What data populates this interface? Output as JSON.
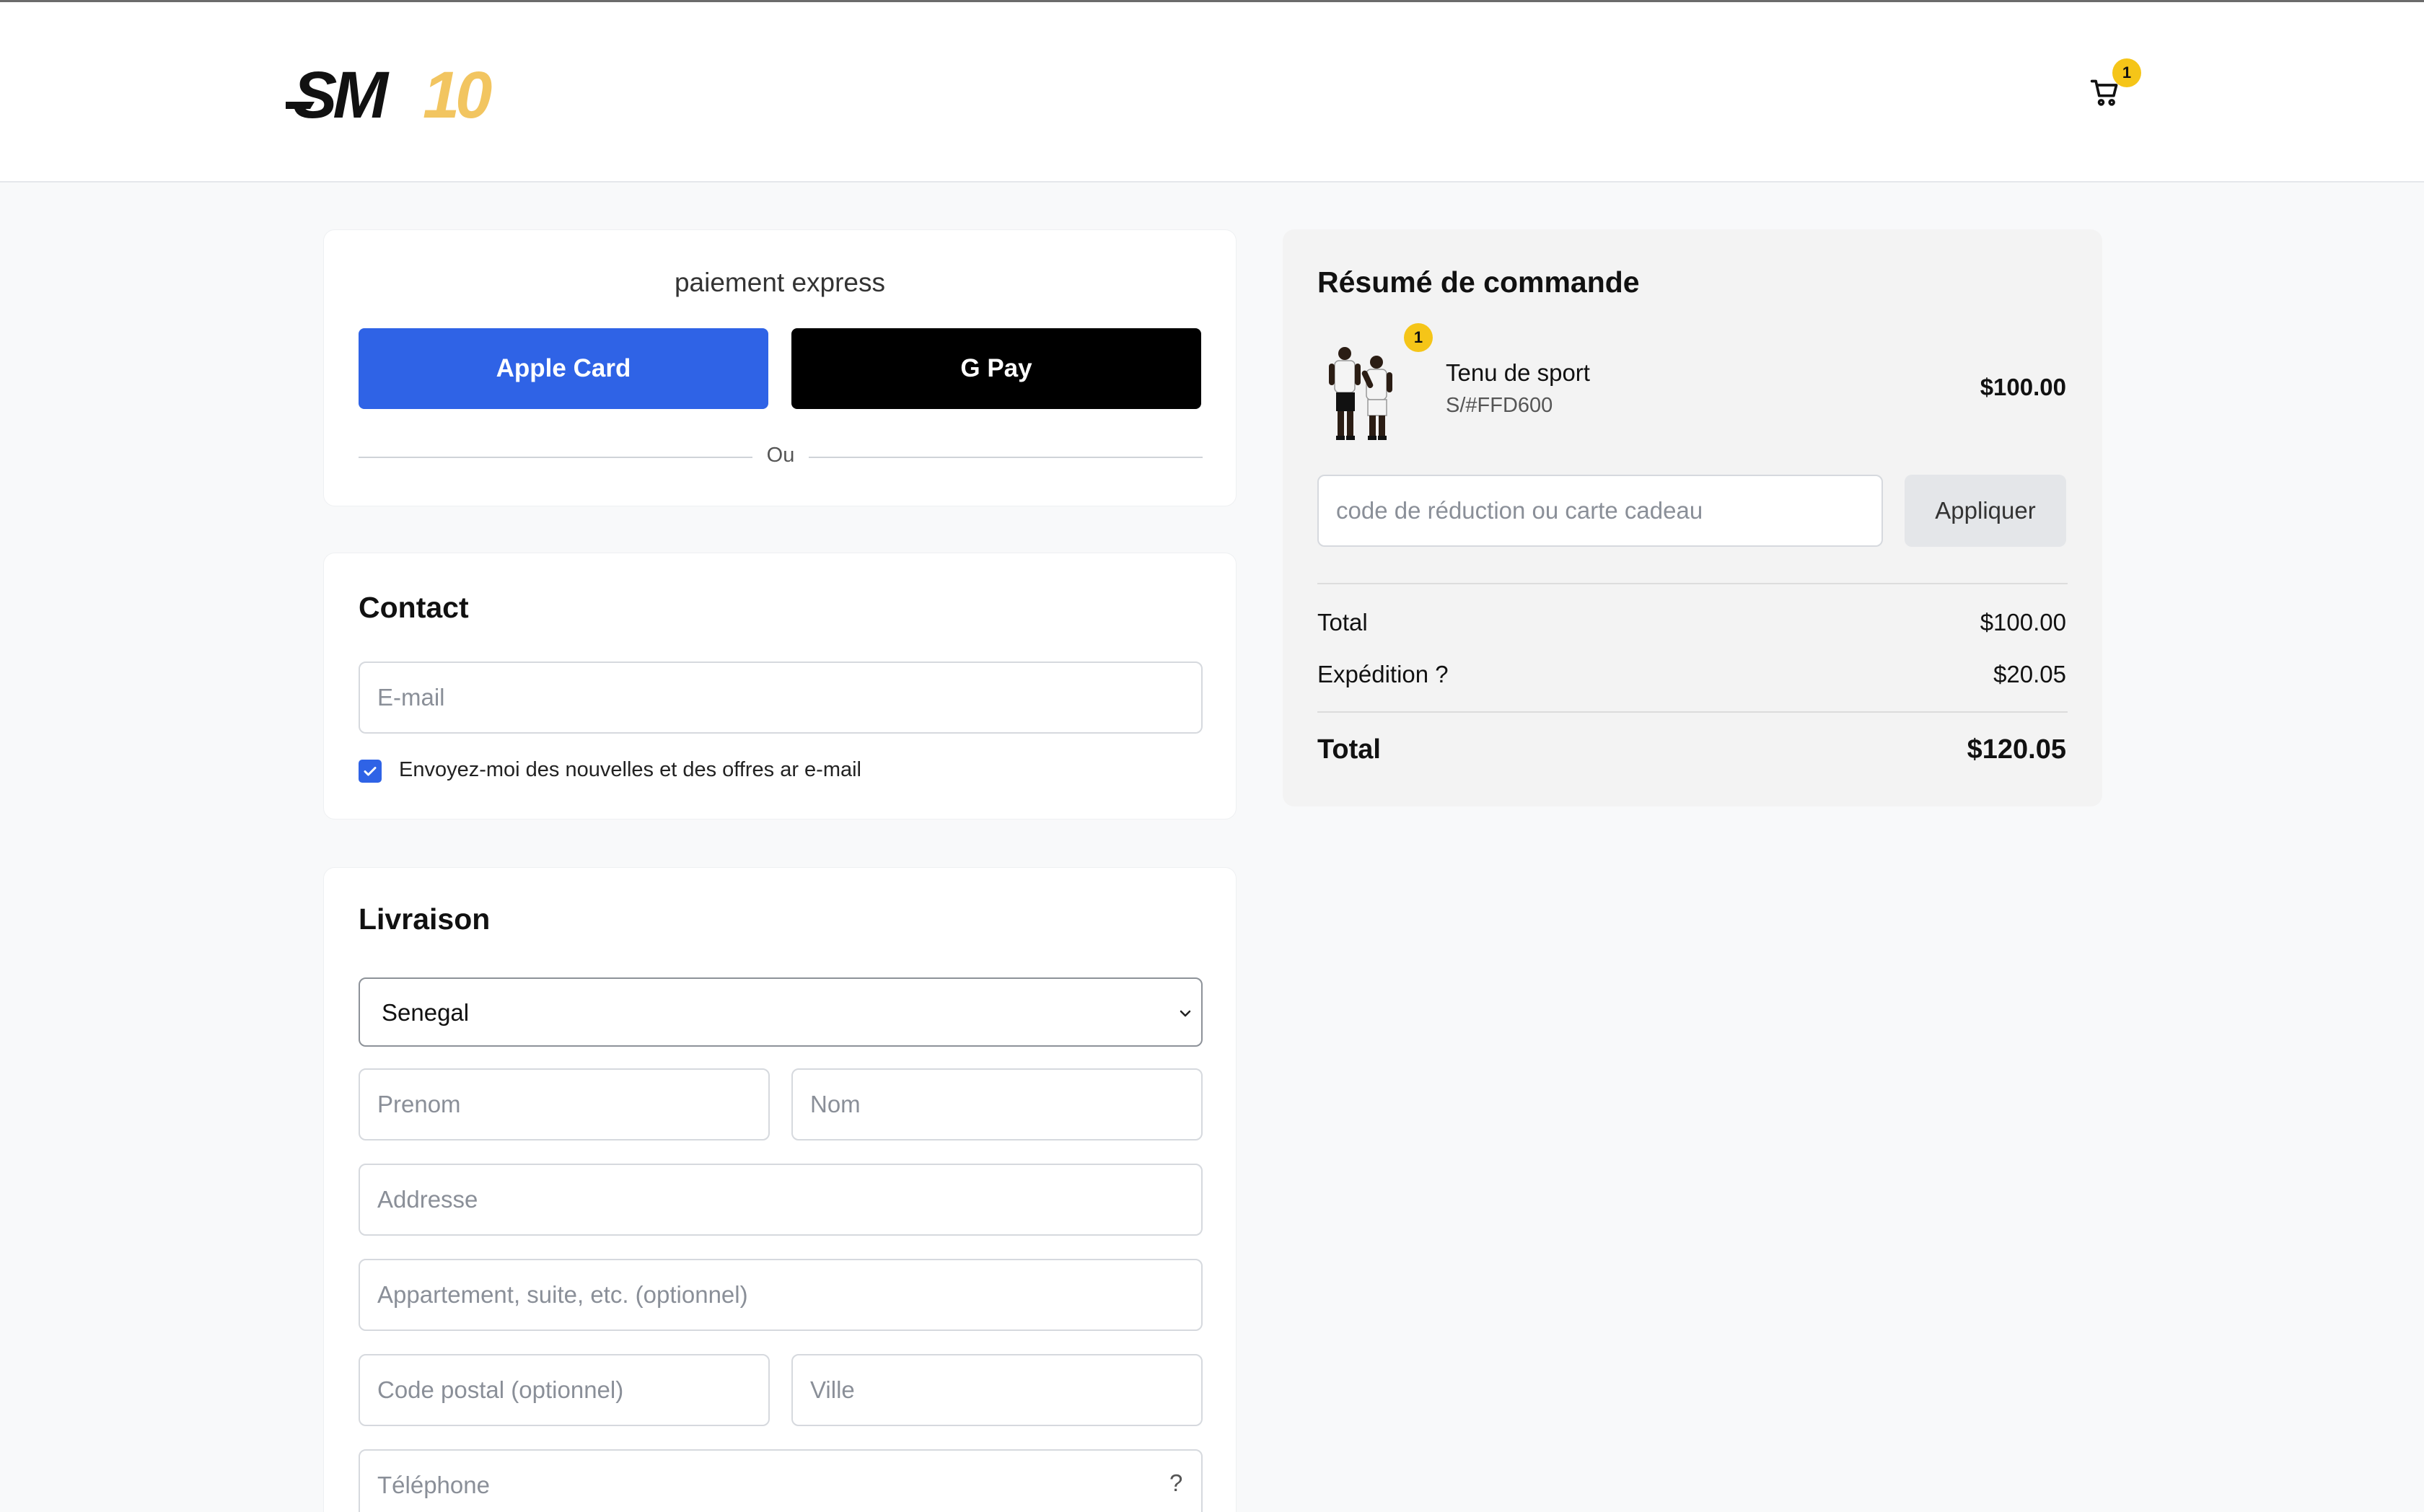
{
  "header": {
    "logo_text": "SM10",
    "cart_count": "1"
  },
  "express": {
    "title": "paiement express",
    "apple_label": "Apple Card",
    "gpay_label": "G Pay",
    "divider_text": "Ou"
  },
  "contact": {
    "title": "Contact",
    "email_placeholder": "E-mail",
    "newsletter_label": "Envoyez-moi des nouvelles et des offres ar e-mail",
    "newsletter_checked": true
  },
  "shipping": {
    "title": "Livraison",
    "country": "Senegal",
    "first_name_placeholder": "Prenom",
    "last_name_placeholder": "Nom",
    "address_placeholder": "Addresse",
    "apartment_placeholder": "Appartement, suite, etc. (optionnel)",
    "postal_placeholder": "Code postal (optionnel)",
    "city_placeholder": "Ville",
    "phone_placeholder": "Téléphone",
    "phone_help": "?"
  },
  "summary": {
    "title": "Résumé de commande",
    "item": {
      "name": "Tenu de sport",
      "variant": "S/#FFD600",
      "price": "$100.00",
      "quantity": "1"
    },
    "discount_placeholder": "code de réduction ou carte cadeau",
    "apply_label": "Appliquer",
    "subtotal_label": "Total",
    "subtotal_value": "$100.00",
    "shipping_label": "Expédition ?",
    "shipping_value": "$20.05",
    "total_label": "Total",
    "total_value": "$120.05"
  },
  "colors": {
    "accent_blue": "#2f63e6",
    "badge_yellow": "#f5c518",
    "logo_gold": "#f2c560"
  }
}
